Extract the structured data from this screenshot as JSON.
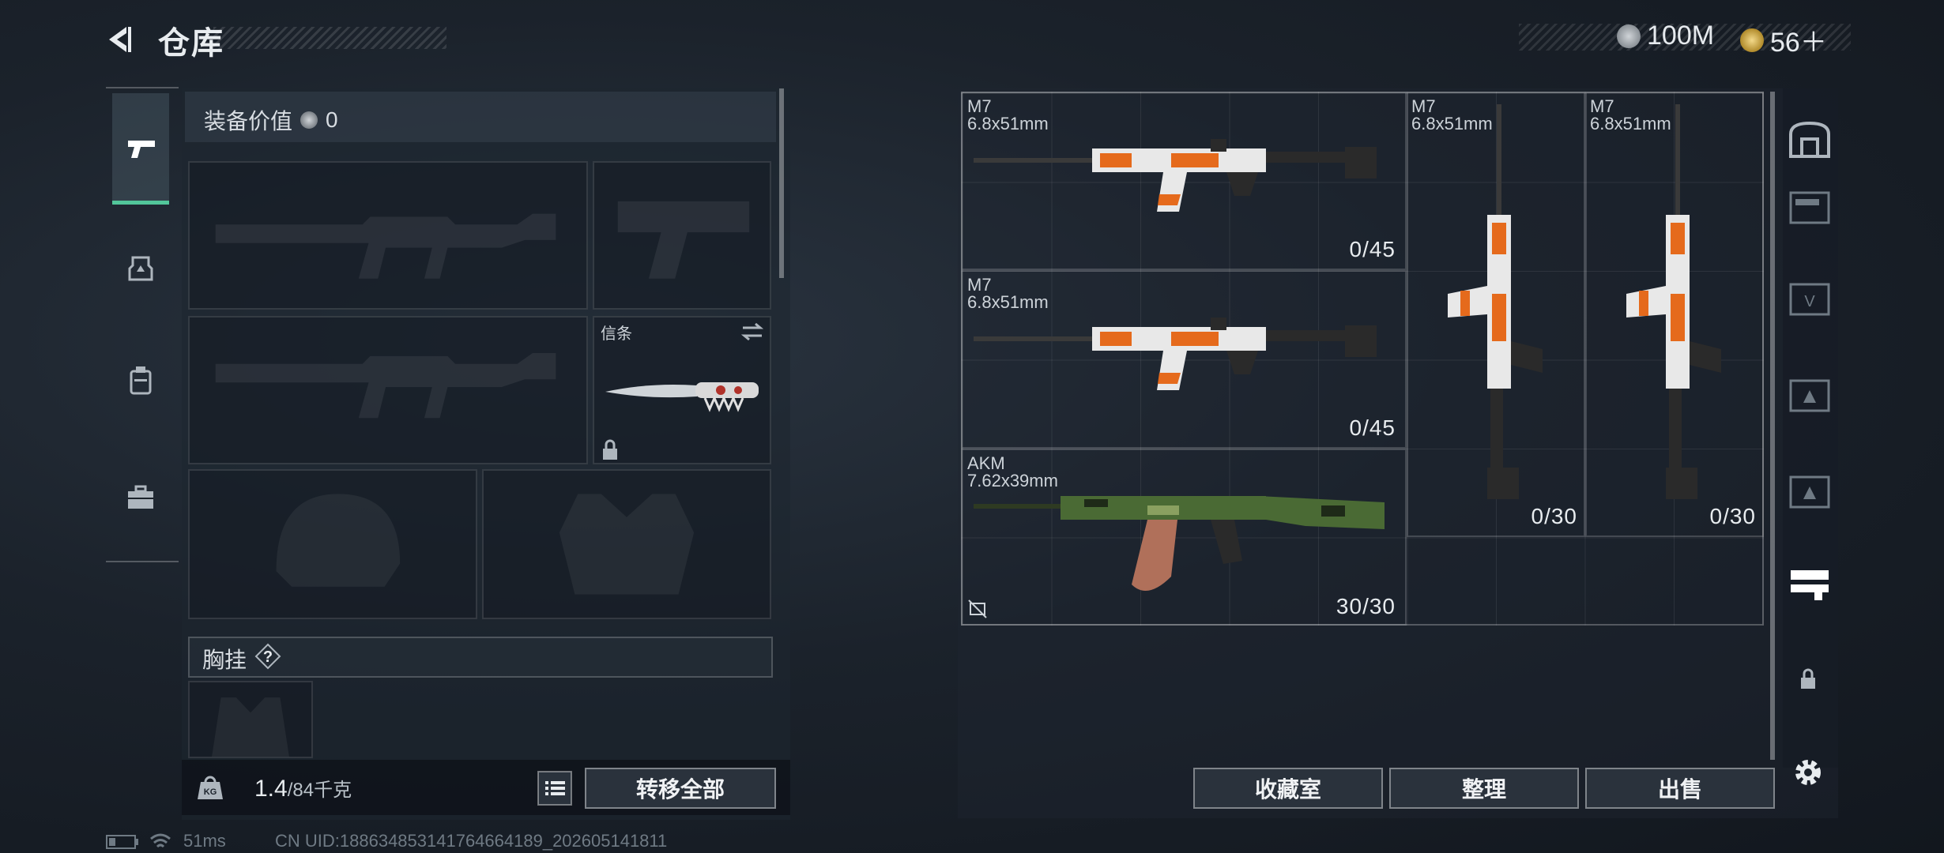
{
  "header": {
    "title": "仓库",
    "currency_silver": "100M",
    "currency_gold": "56＋"
  },
  "equipment": {
    "title": "装备价值",
    "value": "0",
    "melee_slot_label": "信条",
    "chest_label": "胸挂",
    "weight": "1.4",
    "weight_max": "/84千克",
    "transfer_all": "转移全部"
  },
  "stash": {
    "items": [
      {
        "name": "M7",
        "caliber": "6.8x51mm",
        "count": "0/45"
      },
      {
        "name": "M7",
        "caliber": "6.8x51mm",
        "count": "0/45"
      },
      {
        "name": "AKM",
        "caliber": "7.62x39mm",
        "count": "30/30"
      },
      {
        "name": "M7",
        "caliber": "6.8x51mm",
        "count": "0/30"
      },
      {
        "name": "M7",
        "caliber": "6.8x51mm",
        "count": "0/30"
      }
    ],
    "btn_collection": "收藏室",
    "btn_sort": "整理",
    "btn_sell": "出售"
  },
  "status_bar": {
    "ping": "51ms",
    "uid": "CN UID:18863485314176466418​9_202605141811"
  },
  "colors": {
    "accent": "#52c69a",
    "weapon_orange": "#e56a1c"
  }
}
